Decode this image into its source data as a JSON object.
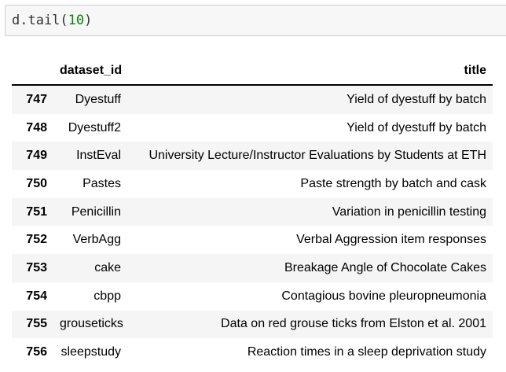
{
  "code_cell": {
    "prefix": "d.tail(",
    "arg": "10",
    "suffix": ")"
  },
  "table": {
    "columns": [
      "",
      "dataset_id",
      "title"
    ],
    "rows": [
      {
        "index": "747",
        "dataset_id": "Dyestuff",
        "title": "Yield of dyestuff by batch"
      },
      {
        "index": "748",
        "dataset_id": "Dyestuff2",
        "title": "Yield of dyestuff by batch"
      },
      {
        "index": "749",
        "dataset_id": "InstEval",
        "title": "University Lecture/Instructor Evaluations by Students at ETH"
      },
      {
        "index": "750",
        "dataset_id": "Pastes",
        "title": "Paste strength by batch and cask"
      },
      {
        "index": "751",
        "dataset_id": "Penicillin",
        "title": "Variation in penicillin testing"
      },
      {
        "index": "752",
        "dataset_id": "VerbAgg",
        "title": "Verbal Aggression item responses"
      },
      {
        "index": "753",
        "dataset_id": "cake",
        "title": "Breakage Angle of Chocolate Cakes"
      },
      {
        "index": "754",
        "dataset_id": "cbpp",
        "title": "Contagious bovine pleuropneumonia"
      },
      {
        "index": "755",
        "dataset_id": "grouseticks",
        "title": "Data on red grouse ticks from Elston et al. 2001"
      },
      {
        "index": "756",
        "dataset_id": "sleepstudy",
        "title": "Reaction times in a sleep deprivation study"
      }
    ]
  }
}
